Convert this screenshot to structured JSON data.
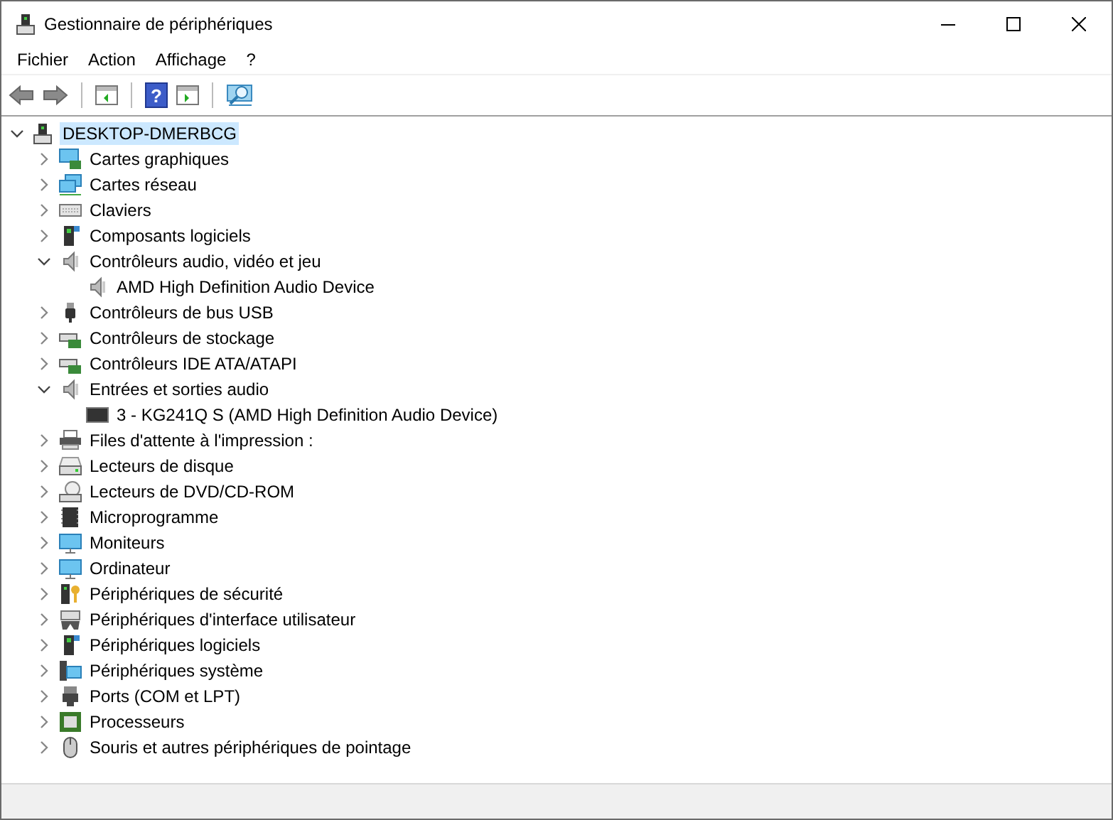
{
  "window": {
    "title": "Gestionnaire de périphériques"
  },
  "menu": [
    {
      "label": "Fichier"
    },
    {
      "label": "Action"
    },
    {
      "label": "Affichage"
    },
    {
      "label": "?"
    }
  ],
  "toolbar": {
    "help_glyph": "?"
  },
  "tree": {
    "label": "DESKTOP-DMERBCG",
    "selected": true,
    "expanded": true,
    "children": [
      {
        "label": "Cartes graphiques",
        "expanded": false
      },
      {
        "label": "Cartes réseau",
        "expanded": false
      },
      {
        "label": "Claviers",
        "expanded": false
      },
      {
        "label": "Composants logiciels",
        "expanded": false
      },
      {
        "label": "Contrôleurs audio, vidéo et jeu",
        "expanded": true,
        "children": [
          {
            "label": "AMD High Definition Audio Device"
          }
        ]
      },
      {
        "label": "Contrôleurs de bus USB",
        "expanded": false
      },
      {
        "label": "Contrôleurs de stockage",
        "expanded": false
      },
      {
        "label": "Contrôleurs IDE ATA/ATAPI",
        "expanded": false
      },
      {
        "label": "Entrées et sorties audio",
        "expanded": true,
        "children": [
          {
            "label": "3 - KG241Q S (AMD High Definition Audio Device)"
          }
        ]
      },
      {
        "label": "Files d'attente à l'impression :",
        "expanded": false
      },
      {
        "label": "Lecteurs de disque",
        "expanded": false
      },
      {
        "label": "Lecteurs de DVD/CD-ROM",
        "expanded": false
      },
      {
        "label": "Microprogramme",
        "expanded": false
      },
      {
        "label": "Moniteurs",
        "expanded": false
      },
      {
        "label": "Ordinateur",
        "expanded": false
      },
      {
        "label": "Périphériques de sécurité",
        "expanded": false
      },
      {
        "label": "Périphériques d'interface utilisateur",
        "expanded": false
      },
      {
        "label": "Périphériques logiciels",
        "expanded": false
      },
      {
        "label": "Périphériques système",
        "expanded": false
      },
      {
        "label": "Ports (COM et LPT)",
        "expanded": false
      },
      {
        "label": "Processeurs",
        "expanded": false
      },
      {
        "label": "Souris et autres périphériques de pointage",
        "expanded": false
      }
    ]
  }
}
